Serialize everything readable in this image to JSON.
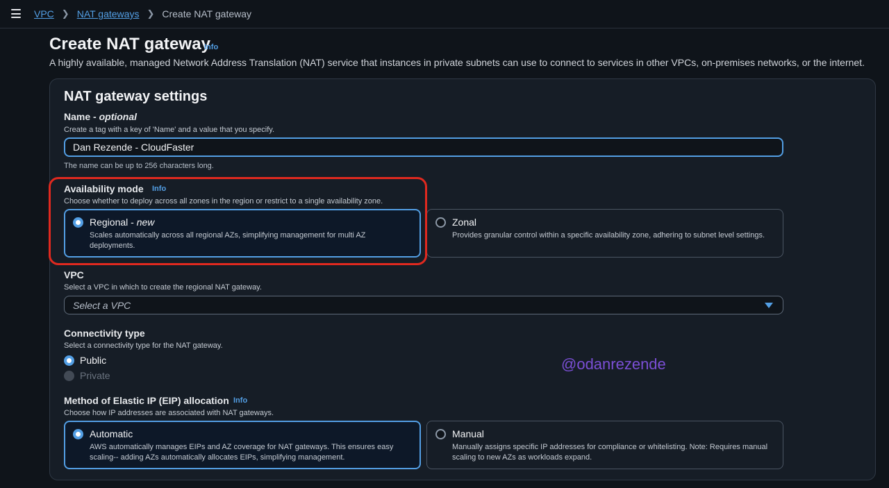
{
  "breadcrumb": {
    "items": [
      "VPC",
      "NAT gateways"
    ],
    "current": "Create NAT gateway"
  },
  "header": {
    "title": "Create NAT gateway",
    "info": "Info",
    "description": "A highly available, managed Network Address Translation (NAT) service that instances in private subnets can use to connect to services in other VPCs, on-premises networks, or the internet."
  },
  "settings": {
    "title": "NAT gateway settings",
    "name": {
      "label": "Name",
      "label_suffix": "optional",
      "description": "Create a tag with a key of 'Name' and a value that you specify.",
      "value": "Dan Rezende - CloudFaster",
      "hint": "The name can be up to 256 characters long."
    },
    "availability_mode": {
      "label": "Availability mode",
      "info": "Info",
      "description": "Choose whether to deploy across all zones in the region or restrict to a single availability zone.",
      "options": [
        {
          "label": "Regional",
          "tag": "new",
          "description": "Scales automatically across all regional AZs, simplifying management for multi AZ deployments.",
          "selected": true
        },
        {
          "label": "Zonal",
          "description": "Provides granular control within a specific availability zone, adhering to subnet level settings.",
          "selected": false
        }
      ]
    },
    "vpc": {
      "label": "VPC",
      "description": "Select a VPC in which to create the regional NAT gateway.",
      "placeholder": "Select a VPC"
    },
    "connectivity": {
      "label": "Connectivity type",
      "description": "Select a connectivity type for the NAT gateway.",
      "options": [
        {
          "label": "Public",
          "selected": true,
          "disabled": false
        },
        {
          "label": "Private",
          "selected": false,
          "disabled": true
        }
      ]
    },
    "eip": {
      "label": "Method of Elastic IP (EIP) allocation",
      "info": "Info",
      "description": "Choose how IP addresses are associated with NAT gateways.",
      "options": [
        {
          "label": "Automatic",
          "description": "AWS automatically manages EIPs and AZ coverage for NAT gateways. This ensures easy scaling-- adding AZs automatically allocates EIPs, simplifying management.",
          "selected": true
        },
        {
          "label": "Manual",
          "description": "Manually assigns specific IP addresses for compliance or whitelisting. Note: Requires manual scaling to new AZs as workloads expand.",
          "selected": false
        }
      ]
    }
  },
  "watermark": "@odanrezende",
  "colors": {
    "accent": "#539fe5",
    "highlight": "#e0291f",
    "background": "#0f141a",
    "panel": "#161d26",
    "watermark": "#7b4fd6"
  }
}
